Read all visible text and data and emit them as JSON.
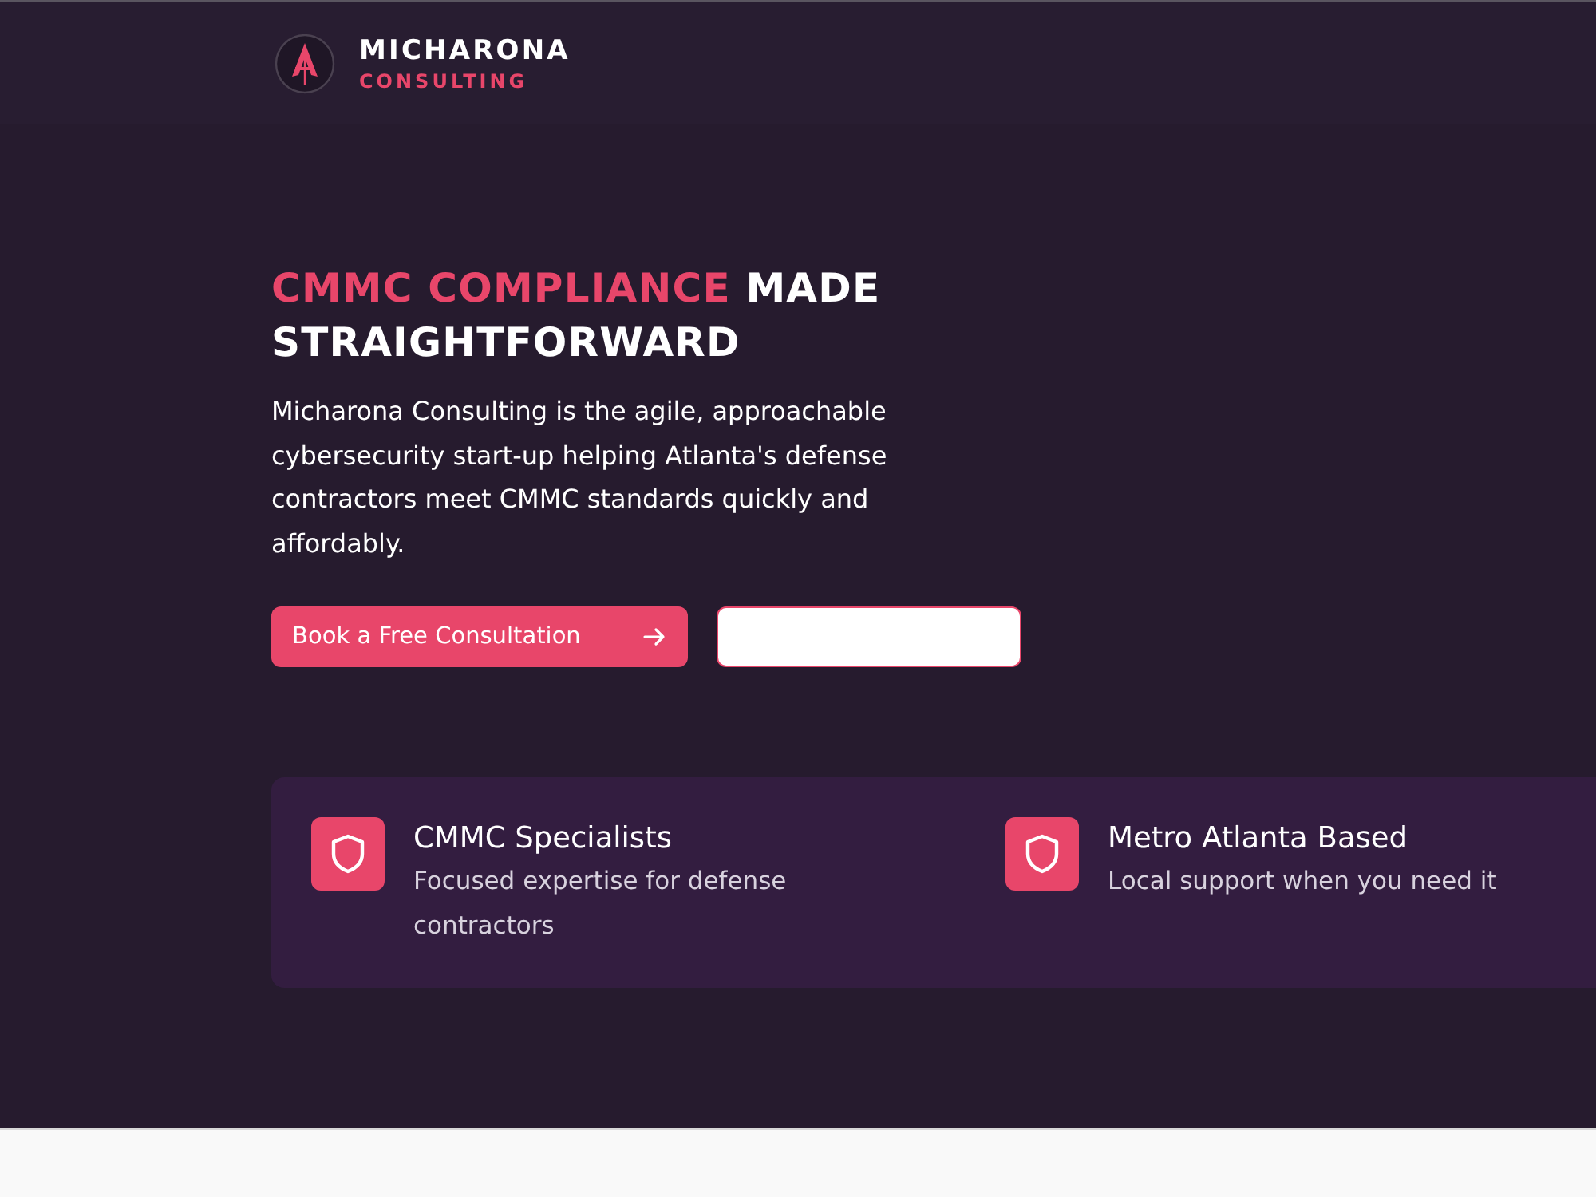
{
  "header": {
    "brand": "MICHARONA",
    "tagline": "CONSULTING"
  },
  "hero": {
    "headline": [
      {
        "text": "CMMC COMPLIANCE",
        "accent": true
      },
      {
        "text": "MADE STRAIGHTFORWARD",
        "accent": false
      }
    ],
    "description": "Micharona Consulting is the agile, approachable cybersecurity start-up helping Atlanta's defense contractors meet CMMC standards quickly and affordably.",
    "buttons": [
      {
        "kind": "primary",
        "label": "Book a Free Consultation"
      },
      {
        "kind": "outline"
      }
    ]
  },
  "features": [
    {
      "title": "CMMC Specialists",
      "description": "Focused expertise for defense contractors"
    },
    {
      "title": "Metro Atlanta Based",
      "description": "Local support when you need it"
    }
  ]
}
